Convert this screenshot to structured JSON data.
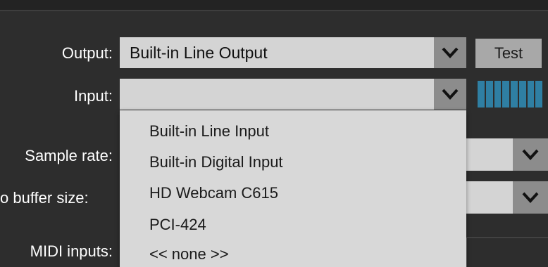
{
  "labels": {
    "output": "Output:",
    "input": "Input:",
    "sample_rate": "Sample rate:",
    "buffer_size": "o buffer size:",
    "midi_inputs": "MIDI inputs:"
  },
  "output_select": {
    "value": "Built-in Line Output"
  },
  "input_select": {
    "value": ""
  },
  "test_button": {
    "label": "Test"
  },
  "input_dropdown": {
    "options": [
      "Built-in Line Input",
      "Built-in Digital Input",
      "HD Webcam C615",
      "PCI-424",
      "<< none >>"
    ]
  },
  "icons": {
    "chevron": "chevron-down-icon"
  },
  "colors": {
    "panel_bg": "#2d2d2d",
    "combo_bg": "#d4d4d4",
    "arrow_bg": "#8c8c8c",
    "meter": "#2f7fa3"
  }
}
